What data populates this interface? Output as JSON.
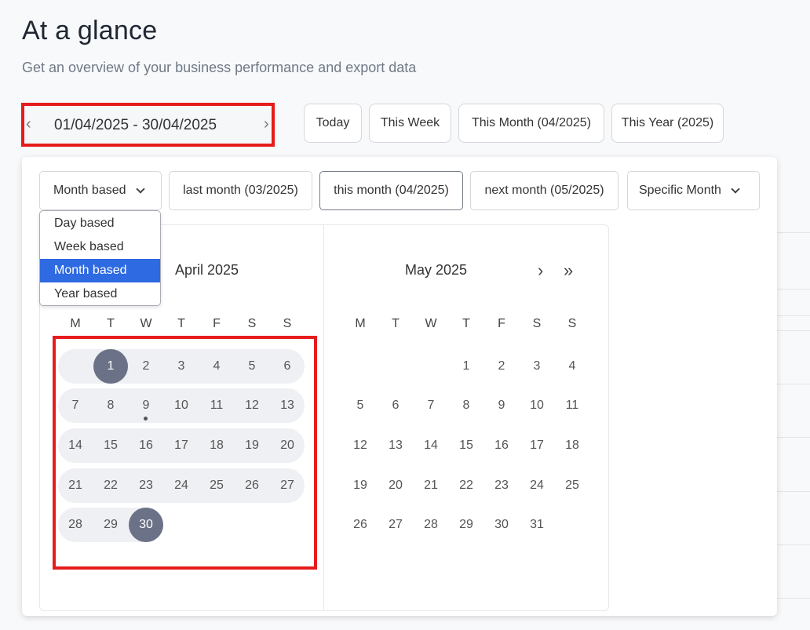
{
  "header": {
    "title": "At a glance",
    "subtitle": "Get an overview of your business performance and export data"
  },
  "range": {
    "value": "01/04/2025 - 30/04/2025",
    "prev_icon": "chevron-left-icon",
    "next_icon": "chevron-right-icon"
  },
  "quick_buttons": {
    "today": "Today",
    "this_week": "This Week",
    "this_month": "This Month (04/2025)",
    "this_year": "This Year (2025)"
  },
  "mode_bar": {
    "mode_select": "Month based",
    "last_month": "last month (03/2025)",
    "this_month": "this month (04/2025)",
    "next_month": "next month (05/2025)",
    "specific_month": "Specific Month"
  },
  "mode_dropdown": {
    "options": [
      "Day based",
      "Week based",
      "Month based",
      "Year based"
    ],
    "selected": "Month based"
  },
  "calendar": {
    "weekday_headers": [
      "M",
      "T",
      "W",
      "T",
      "F",
      "S",
      "S"
    ],
    "left": {
      "title": "April 2025",
      "weeks": [
        [
          "",
          "1",
          "2",
          "3",
          "4",
          "5",
          "6"
        ],
        [
          "7",
          "8",
          "9",
          "10",
          "11",
          "12",
          "13"
        ],
        [
          "14",
          "15",
          "16",
          "17",
          "18",
          "19",
          "20"
        ],
        [
          "21",
          "22",
          "23",
          "24",
          "25",
          "26",
          "27"
        ],
        [
          "28",
          "29",
          "30",
          "",
          "",
          "",
          ""
        ]
      ],
      "range_start": "1",
      "range_end": "30",
      "today": "9"
    },
    "right": {
      "title": "May 2025",
      "next_icon": "chevron-right-icon",
      "next_year_icon": "double-chevron-right-icon",
      "weeks": [
        [
          "",
          "",
          "",
          "1",
          "2",
          "3",
          "4"
        ],
        [
          "5",
          "6",
          "7",
          "8",
          "9",
          "10",
          "11"
        ],
        [
          "12",
          "13",
          "14",
          "15",
          "16",
          "17",
          "18"
        ],
        [
          "19",
          "20",
          "21",
          "22",
          "23",
          "24",
          "25"
        ],
        [
          "26",
          "27",
          "28",
          "29",
          "30",
          "31",
          ""
        ]
      ]
    }
  },
  "colors": {
    "highlight_red": "#e61c1c",
    "selected_day": "#6b7186",
    "range_band": "#eef0f3",
    "dropdown_selected": "#2e6ae1"
  }
}
